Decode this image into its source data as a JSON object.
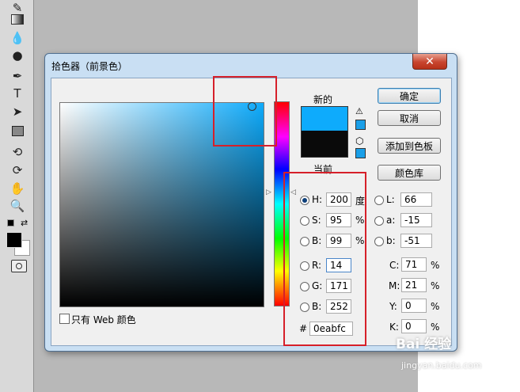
{
  "window": {
    "title": "拾色器（前景色）",
    "close_glyph": "✕"
  },
  "toolbar": {
    "icons": [
      "pencil-icon",
      "gradient-icon",
      "blur-drop-icon",
      "sponge-icon",
      "pen-icon",
      "type-icon",
      "path-select-icon",
      "rectangle-icon",
      "3d-rotate-icon",
      "3d-orbit-icon",
      "hand-icon",
      "zoom-icon"
    ]
  },
  "swatches": {
    "new_label": "新的",
    "current_label": "当前",
    "new_color": "#0eabfc",
    "current_color": "#0a0a0a"
  },
  "buttons": {
    "ok": "确定",
    "cancel": "取消",
    "add_to_swatches": "添加到色板",
    "color_libraries": "颜色库"
  },
  "fields": {
    "H": {
      "label": "H:",
      "value": "200",
      "unit": "度",
      "selected": true
    },
    "S": {
      "label": "S:",
      "value": "95",
      "unit": "%"
    },
    "Bv": {
      "label": "B:",
      "value": "99",
      "unit": "%"
    },
    "R": {
      "label": "R:",
      "value": "14"
    },
    "G": {
      "label": "G:",
      "value": "171"
    },
    "Bl": {
      "label": "B:",
      "value": "252"
    },
    "L": {
      "label": "L:",
      "value": "66"
    },
    "a": {
      "label": "a:",
      "value": "-15"
    },
    "b": {
      "label": "b:",
      "value": "-51"
    },
    "C": {
      "label": "C:",
      "value": "71",
      "unit": "%"
    },
    "M": {
      "label": "M:",
      "value": "21",
      "unit": "%"
    },
    "Y": {
      "label": "Y:",
      "value": "0",
      "unit": "%"
    },
    "K": {
      "label": "K:",
      "value": "0",
      "unit": "%"
    },
    "hex": {
      "label": "#",
      "value": "0eabfc"
    }
  },
  "web_only": {
    "label": "只有 Web 颜色",
    "checked": false
  },
  "watermark": {
    "logo": "Bai 经验",
    "url": "jingyan.baidu.com"
  },
  "colors": {
    "highlight": "#d6202a",
    "selected": "#0eabfc"
  }
}
